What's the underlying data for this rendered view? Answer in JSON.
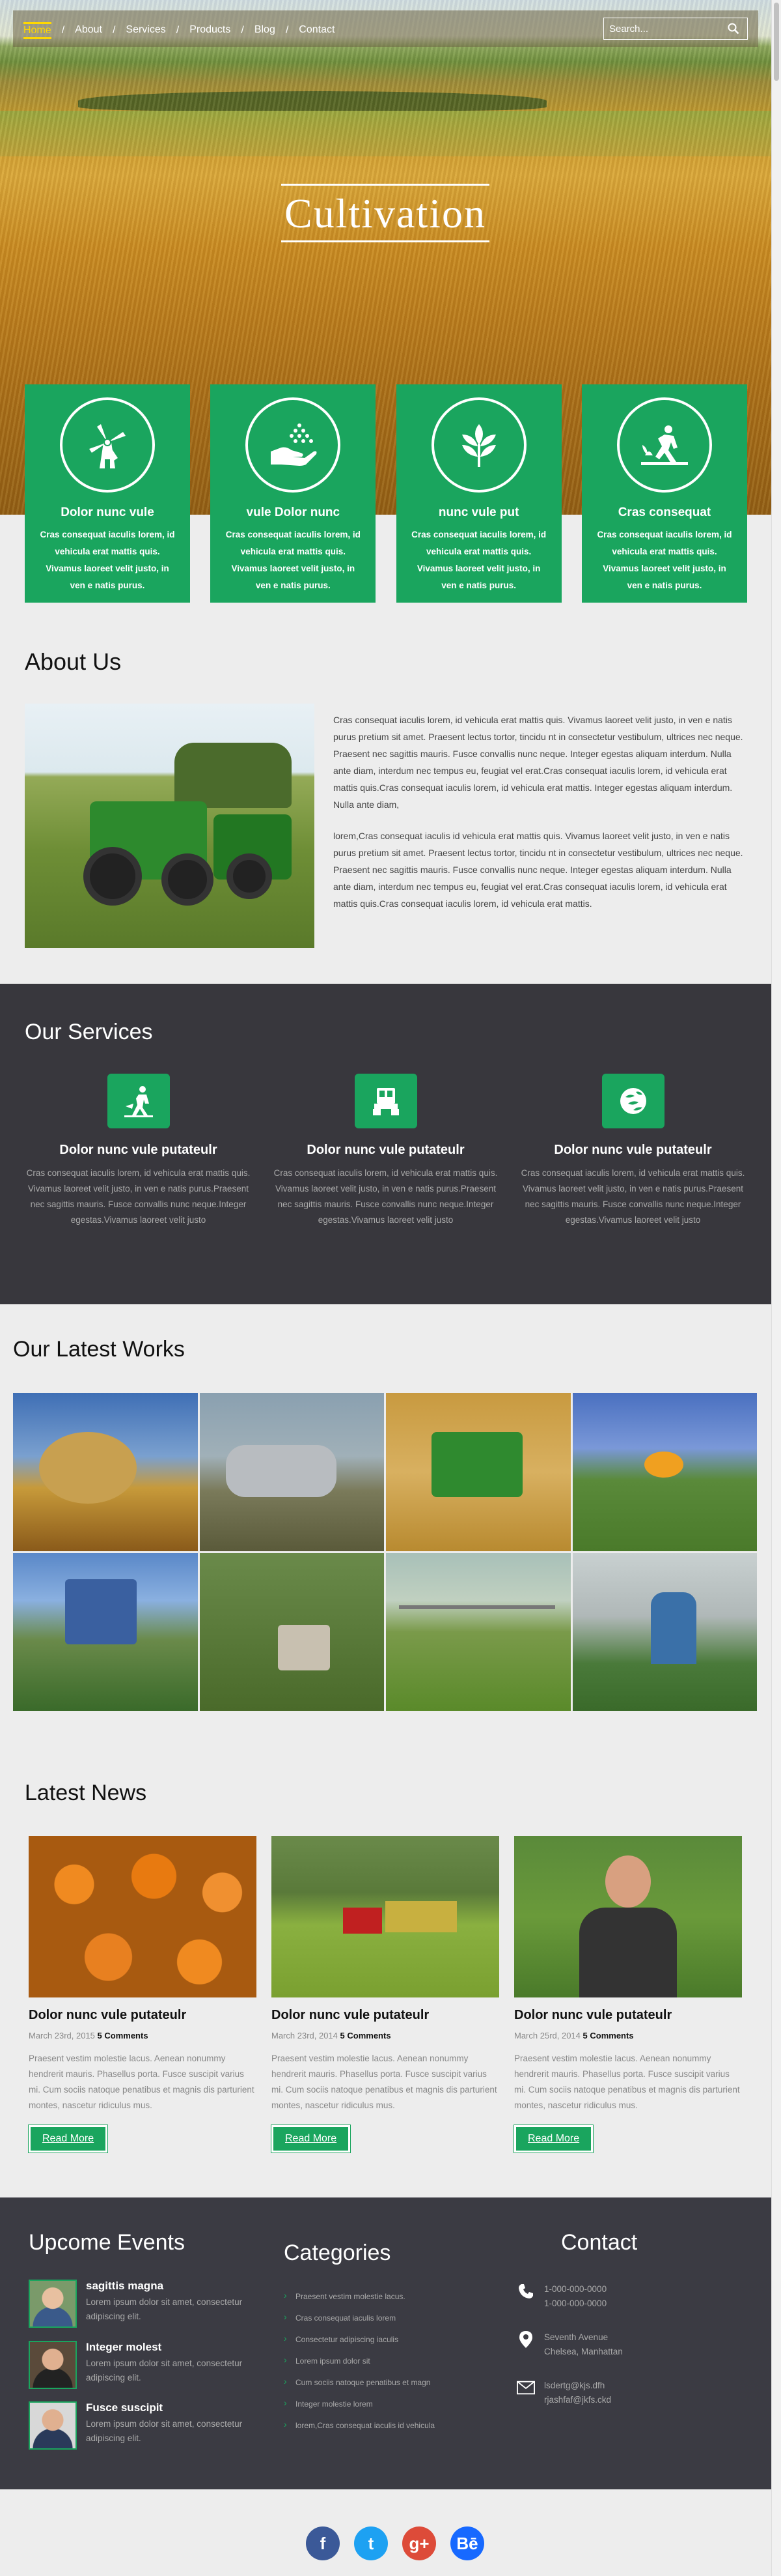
{
  "nav": {
    "items": [
      "Home",
      "About",
      "Services",
      "Products",
      "Blog",
      "Contact"
    ],
    "active": "Home"
  },
  "search": {
    "placeholder": "Search..."
  },
  "hero": {
    "title": "Cultivation"
  },
  "features": [
    {
      "title": "Dolor nunc vule",
      "text": "Cras consequat iaculis lorem, id vehicula erat mattis quis. Vivamus laoreet velit justo, in ven e natis purus.",
      "icon": "windmill-icon"
    },
    {
      "title": "vule Dolor nunc",
      "text": "Cras consequat iaculis lorem, id vehicula erat mattis quis. Vivamus laoreet velit justo, in ven e natis purus.",
      "icon": "seeding-hand-icon"
    },
    {
      "title": "nunc vule put",
      "text": "Cras consequat iaculis lorem, id vehicula erat mattis quis. Vivamus laoreet velit justo, in ven e natis purus.",
      "icon": "sprout-leaves-icon"
    },
    {
      "title": "Cras consequat",
      "text": "Cras consequat iaculis lorem, id vehicula erat mattis quis. Vivamus laoreet velit justo, in ven e natis purus.",
      "icon": "farmer-planting-icon"
    }
  ],
  "about": {
    "title": "About Us",
    "p1": "Cras consequat iaculis lorem, id vehicula erat mattis quis. Vivamus laoreet velit justo, in ven e natis purus pretium sit amet. Praesent lectus tortor, tincidu nt in consectetur vestibulum, ultrices nec neque. Praesent nec sagittis mauris. Fusce convallis nunc neque. Integer egestas aliquam interdum. Nulla ante diam, interdum nec tempus eu, feugiat vel erat.Cras consequat iaculis lorem, id vehicula erat mattis quis.Cras consequat iaculis lorem, id vehicula erat mattis. Integer egestas aliquam interdum. Nulla ante diam,",
    "p2": "lorem,Cras consequat iaculis id vehicula erat mattis quis. Vivamus laoreet velit justo, in ven e natis purus pretium sit amet. Praesent lectus tortor, tincidu nt in consectetur vestibulum, ultrices nec neque. Praesent nec sagittis mauris. Fusce convallis nunc neque. Integer egestas aliquam interdum. Nulla ante diam, interdum nec tempus eu, feugiat vel erat.Cras consequat iaculis lorem, id vehicula erat mattis quis.Cras consequat iaculis lorem, id vehicula erat mattis."
  },
  "services": {
    "title": "Our Services",
    "items": [
      {
        "title": "Dolor nunc vule putateulr",
        "text": "Cras consequat iaculis lorem, id vehicula erat mattis quis. Vivamus laoreet velit justo, in ven e natis purus.Praesent nec sagittis mauris. Fusce convallis nunc neque.Integer egestas.Vivamus laoreet velit justo",
        "icon": "farmer-watering-icon"
      },
      {
        "title": "Dolor nunc vule putateulr",
        "text": "Cras consequat iaculis lorem, id vehicula erat mattis quis. Vivamus laoreet velit justo, in ven e natis purus.Praesent nec sagittis mauris. Fusce convallis nunc neque.Integer egestas.Vivamus laoreet velit justo",
        "icon": "tractor-icon"
      },
      {
        "title": "Dolor nunc vule putateulr",
        "text": "Cras consequat iaculis lorem, id vehicula erat mattis quis. Vivamus laoreet velit justo, in ven e natis purus.Praesent nec sagittis mauris. Fusce convallis nunc neque.Integer egestas.Vivamus laoreet velit justo",
        "icon": "hops-icon"
      }
    ]
  },
  "works": {
    "title": "Our Latest Works"
  },
  "news": {
    "title": "Latest News",
    "items": [
      {
        "title": "Dolor nunc vule putateulr",
        "date": "March 23rd, 2015",
        "comments": "5 Comments",
        "text": "Praesent vestim molestie lacus. Aenean nonummy hendrerit mauris. Phasellus porta. Fusce suscipit varius mi. Cum sociis natoque penatibus et magnis dis parturient montes, nascetur ridiculus mus.",
        "button": "Read More"
      },
      {
        "title": "Dolor nunc vule putateulr",
        "date": "March 23rd, 2014",
        "comments": "5 Comments",
        "text": "Praesent vestim molestie lacus. Aenean nonummy hendrerit mauris. Phasellus porta. Fusce suscipit varius mi. Cum sociis natoque penatibus et magnis dis parturient montes, nascetur ridiculus mus.",
        "button": "Read More"
      },
      {
        "title": "Dolor nunc vule putateulr",
        "date": "March 25rd, 2014",
        "comments": "5 Comments",
        "text": "Praesent vestim molestie lacus. Aenean nonummy hendrerit mauris. Phasellus porta. Fusce suscipit varius mi. Cum sociis natoque penatibus et magnis dis parturient montes, nascetur ridiculus mus.",
        "button": "Read More"
      }
    ]
  },
  "footer": {
    "events_title": "Upcome Events",
    "events": [
      {
        "name": "sagittis magna",
        "text": "Lorem ipsum dolor sit amet, consectetur adipiscing elit."
      },
      {
        "name": "Integer molest",
        "text": "Lorem ipsum dolor sit amet, consectetur adipiscing elit."
      },
      {
        "name": "Fusce suscipit",
        "text": "Lorem ipsum dolor sit amet, consectetur adipiscing elit."
      }
    ],
    "categories_title": "Categories",
    "categories": [
      "Praesent vestim molestie lacus.",
      "Cras consequat iaculis lorem",
      "Consectetur adipiscing iaculis",
      "Lorem ipsum dolor sit",
      "Cum sociis natoque penatibus et magn",
      "Integer molestie lorem",
      "lorem,Cras consequat iaculis id vehicula"
    ],
    "contact_title": "Contact",
    "phone1": "1-000-000-0000",
    "phone2": "1-000-000-0000",
    "address1": "Seventh Avenue",
    "address2": "Chelsea, Manhattan",
    "email1": "lsdertg@kjs.dfh",
    "email2": "rjashfaf@jkfs.ckd"
  },
  "social": [
    {
      "label": "f",
      "icon": "facebook-icon",
      "color": "#3b5998"
    },
    {
      "label": "t",
      "icon": "twitter-icon",
      "color": "#1da1f2"
    },
    {
      "label": "g+",
      "icon": "google-plus-icon",
      "color": "#dd4b39"
    },
    {
      "label": "Bē",
      "icon": "behance-icon",
      "color": "#1769ff"
    }
  ],
  "colors": {
    "accent": "#1aa55e",
    "dark": "#38373d",
    "footer": "#3b3b43",
    "active_nav": "#ffd800"
  }
}
